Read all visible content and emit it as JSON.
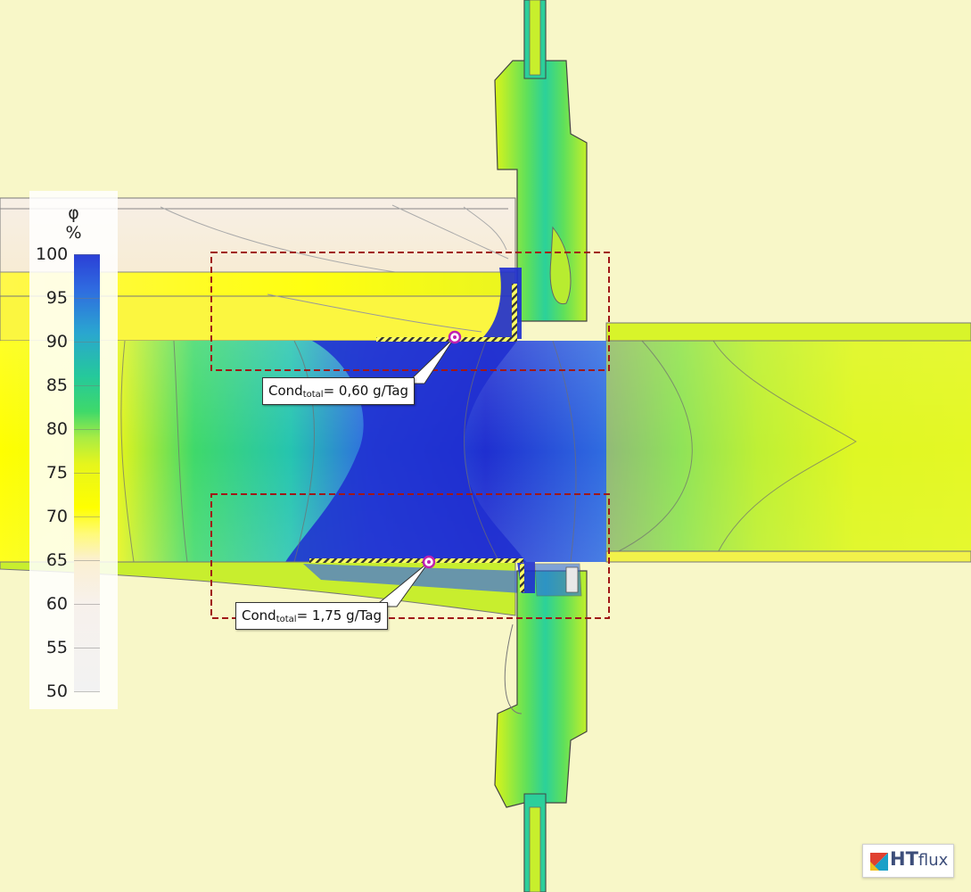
{
  "legend": {
    "symbol": "φ",
    "unit": "%",
    "ticks": [
      "100",
      "95",
      "90",
      "85",
      "80",
      "75",
      "70",
      "65",
      "60",
      "55",
      "50"
    ]
  },
  "callouts": {
    "upper": {
      "main": "Cond",
      "sub": "total",
      "value": "= 0,60 g/Tag"
    },
    "lower": {
      "main": "Cond",
      "sub": "total",
      "value": "= 1,75 g/Tag"
    }
  },
  "logo": {
    "bold": "HT",
    "light": "flux"
  },
  "colors": {
    "background": "#f8f7c8",
    "max_humidity": "#2b3fd6",
    "mid_humidity": "#25c99a",
    "low_humidity": "#f2f2f2",
    "condensation_box": "#a01818"
  }
}
